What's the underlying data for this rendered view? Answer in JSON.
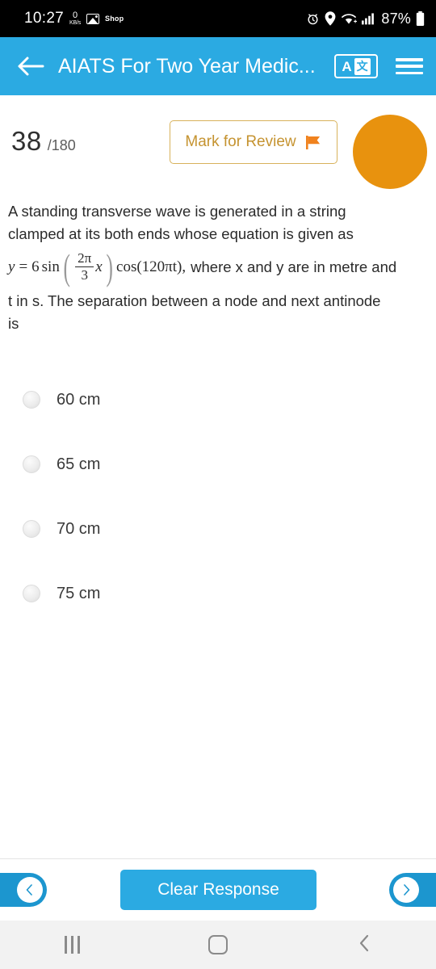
{
  "status_bar": {
    "time": "10:27",
    "data_rate_value": "0",
    "data_rate_unit": "KB/s",
    "shop_label": "Shop",
    "battery_percent": "87%",
    "icons": [
      "image-icon",
      "alarm-icon",
      "location-pin-icon",
      "wifi-icon",
      "signal-bars-icon",
      "battery-icon"
    ]
  },
  "app_bar": {
    "title": "AIATS For Two Year Medic...",
    "back_icon": "back-arrow-icon",
    "translate_icon_letter": "A",
    "translate_icon_cjk": "文",
    "menu_icon": "hamburger-menu-icon",
    "background_color": "#2BAAE2"
  },
  "question_header": {
    "current_number": "38",
    "total": "/180",
    "mark_for_review_label": "Mark for Review",
    "flag_icon": "flag-icon",
    "flag_color": "#F0821E",
    "mark_border_color": "#D8B25B",
    "mark_text_color": "#C59330",
    "avatar_color": "#E8920E",
    "avatar_icon": "user-avatar"
  },
  "question": {
    "line1": "A standing transverse wave is generated in a string",
    "line2": "clamped at its both ends whose equation is given as",
    "equation": {
      "lhs": "y",
      "equals": "=",
      "amplitude": "6",
      "sin": "sin",
      "frac_numerator": "2π",
      "frac_denominator": "3",
      "frac_variable": "x",
      "cos_part": "cos(120πt)",
      "comma": ","
    },
    "line3_tail": "where x and y are in metre and",
    "line4": "t in s. The separation between a node and next antinode",
    "line5": "is"
  },
  "options": [
    {
      "label": "60 cm",
      "selected": false
    },
    {
      "label": "65 cm",
      "selected": false
    },
    {
      "label": "70 cm",
      "selected": false
    },
    {
      "label": "75 cm",
      "selected": false
    }
  ],
  "action_bar": {
    "prev_icon": "chevron-left-icon",
    "next_icon": "chevron-right-icon",
    "clear_response_label": "Clear Response",
    "button_color": "#2BAAE2"
  },
  "android_nav": {
    "recents_icon": "recents-icon",
    "home_icon": "home-icon",
    "back_icon": "back-chevron-icon"
  }
}
